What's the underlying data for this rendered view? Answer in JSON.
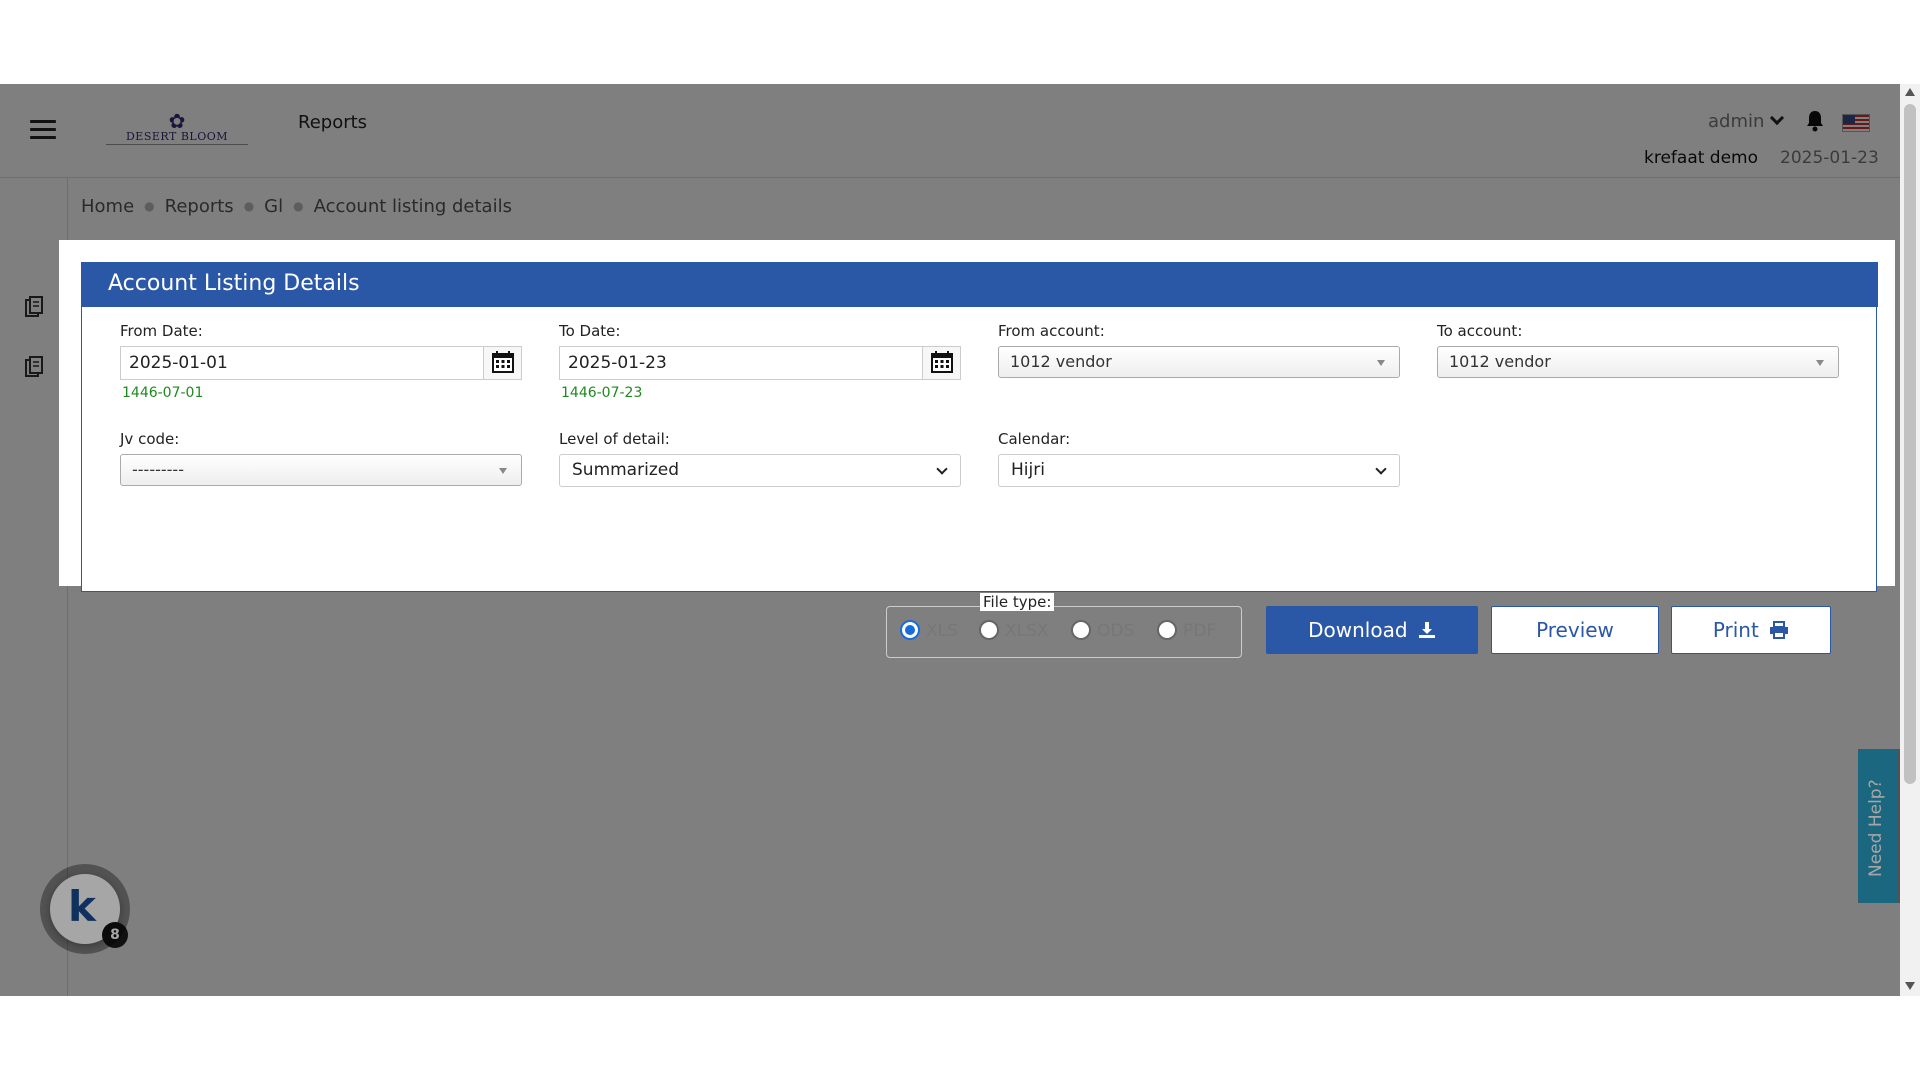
{
  "header": {
    "logo_text": "DESERT BLOOM",
    "app_title": "Reports",
    "user": "admin",
    "company": "krefaat demo",
    "date": "2025-01-23"
  },
  "breadcrumb": [
    "Home",
    "Reports",
    "Gl",
    "Account listing details"
  ],
  "card": {
    "title": "Account Listing Details",
    "from_date": {
      "label": "From Date:",
      "value": "2025-01-01",
      "hijri": "1446-07-01"
    },
    "to_date": {
      "label": "To Date:",
      "value": "2025-01-23",
      "hijri": "1446-07-23"
    },
    "from_account": {
      "label": "From account:",
      "value": "1012 vendor"
    },
    "to_account": {
      "label": "To account:",
      "value": "1012 vendor"
    },
    "jv_code": {
      "label": "Jv code:",
      "value": "---------"
    },
    "level_of_detail": {
      "label": "Level of detail:",
      "value": "Summarized"
    },
    "calendar": {
      "label": "Calendar:",
      "value": "Hijri"
    },
    "file_type": {
      "label": "File type:",
      "options": [
        "XLS",
        "XLSX",
        "ODS",
        "PDF"
      ],
      "selected": "XLS"
    },
    "buttons": {
      "download": "Download",
      "preview": "Preview",
      "print": "Print"
    }
  },
  "floating": {
    "badge_letter": "k",
    "badge_count": "8",
    "need_help": "Need Help?"
  },
  "colors": {
    "primary": "#2b57a7",
    "hijri_green": "#1f8a1f",
    "help_tab": "#2a9ec4"
  },
  "icons": [
    "hamburger-icon",
    "bell-icon",
    "us-flag-icon",
    "calendar-icon",
    "download-icon",
    "printer-icon",
    "report-icon"
  ]
}
